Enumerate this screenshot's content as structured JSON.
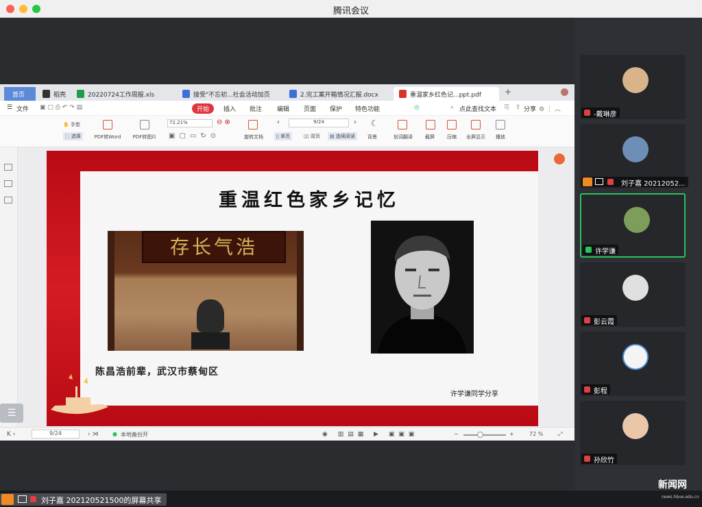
{
  "window": {
    "title": "腾讯会议"
  },
  "wps": {
    "tabs": [
      {
        "label": "首页"
      },
      {
        "label": "稻壳"
      },
      {
        "label": "20220724工作周报.xls"
      },
      {
        "label": "接受\"不忘初...社会活动加页"
      },
      {
        "label": "2.完工案开箱情况汇报.docx"
      },
      {
        "label": "重温家乡红色记...ppt.pdf"
      }
    ],
    "menu": {
      "file": "文件",
      "start": "开始",
      "insert": "插入",
      "comment": "批注",
      "edit": "编辑",
      "page": "页面",
      "protect": "保护",
      "features": "特色功能",
      "search": "点此查找文本",
      "share": "分享"
    },
    "ribbon": {
      "hand": "手型",
      "select": "选择",
      "pdf_word": "PDF转Word",
      "pdf_image": "PDF转图片",
      "zoom": "72.21%",
      "rotate": "旋转文档",
      "page_field": "9/24",
      "single": "单页",
      "double": "双页",
      "continuous": "连续阅读",
      "background": "背景",
      "translate": "划词翻译",
      "screenshot": "截屏",
      "compress": "压缩",
      "fullscreen": "全屏显示",
      "play": "播放"
    },
    "status": {
      "page": "9/24",
      "backup": "本地备份开",
      "zoom": "72 %"
    }
  },
  "slide": {
    "title": "重温红色家乡记忆",
    "plaque": "存长气浩",
    "caption": "陈昌浩前辈，武汉市蔡甸区",
    "credit": "许学谦同学分享"
  },
  "participants": [
    {
      "name": "-戴琳彦",
      "mic": "muted"
    },
    {
      "name": "刘子嘉 20212052...",
      "mic": "muted"
    },
    {
      "name": "许学谦",
      "mic": "on"
    },
    {
      "name": "彭云霞",
      "mic": "muted"
    },
    {
      "name": "彭程",
      "mic": "muted"
    },
    {
      "name": "孙欣竹",
      "mic": "muted"
    }
  ],
  "bottom": {
    "sharer_label": "刘子嘉 202120521500的屏幕共享"
  },
  "watermark": {
    "text": "新闻网",
    "url": "news.hbue.edu.cn"
  },
  "colors": {
    "accent": "#2ac35e",
    "slide_red": "#c8141c",
    "wps_start_tab": "#e0353f"
  }
}
